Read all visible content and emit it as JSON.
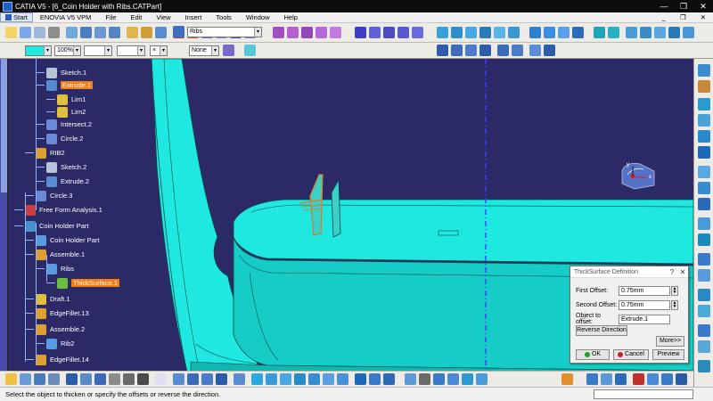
{
  "window": {
    "title": "CATIA V5 - [6_Coin Holder with Ribs.CATPart]",
    "minimize": "—",
    "restore": "❐",
    "close": "✕"
  },
  "menubar": {
    "items": [
      "Start",
      "ENOVIA V5 VPM",
      "File",
      "Edit",
      "View",
      "Insert",
      "Tools",
      "Window",
      "Help"
    ],
    "child_controls": [
      "_",
      "❐",
      "✕"
    ]
  },
  "toolbar2": {
    "color_combo": "",
    "transparency_combo": "100%",
    "linetype_combo": "",
    "thickness_combo": "",
    "point_combo": "×",
    "layer_combo": "None",
    "layer_label": "Ribs"
  },
  "tree": {
    "nodes": [
      {
        "label": "Sketch.1",
        "icon": "sketch-icon"
      },
      {
        "label": "Extrude.1",
        "icon": "extrude-icon",
        "selected": true
      },
      {
        "label": "Lim1",
        "icon": "limit-icon"
      },
      {
        "label": "Lim2",
        "icon": "limit-icon"
      },
      {
        "label": "Intersect.2",
        "icon": "intersect-icon"
      },
      {
        "label": "Circle.2",
        "icon": "circle-icon"
      },
      {
        "label": "RIB2",
        "icon": "geometrical-set-icon"
      },
      {
        "label": "Sketch.2",
        "icon": "sketch-icon"
      },
      {
        "label": "Extrude.2",
        "icon": "extrude-icon"
      },
      {
        "label": "Circle.3",
        "icon": "circle-icon"
      },
      {
        "label": "Free Form Analysis.1",
        "icon": "analysis-icon"
      },
      {
        "label": "Coin Holder Part",
        "icon": "part-icon"
      },
      {
        "label": "Coin Holder Part",
        "icon": "body-icon"
      },
      {
        "label": "Assemble.1",
        "icon": "assemble-icon"
      },
      {
        "label": "Ribs",
        "icon": "body-icon"
      },
      {
        "label": "ThickSurface.1",
        "icon": "thicksurface-icon",
        "selected": true
      },
      {
        "label": "Draft.1",
        "icon": "draft-icon"
      },
      {
        "label": "EdgeFillet.13",
        "icon": "edgefillet-icon"
      },
      {
        "label": "Assemble.2",
        "icon": "assemble-icon"
      },
      {
        "label": "Rib2",
        "icon": "body-icon"
      },
      {
        "label": "EdgeFillet.14",
        "icon": "edgefillet-icon"
      }
    ]
  },
  "dialog": {
    "title": "ThickSurface Definition",
    "help": "?",
    "close": "✕",
    "first_offset_label": "First Offset:",
    "first_offset_value": "0.75mm",
    "second_offset_label": "Second Offset:",
    "second_offset_value": "0.75mm",
    "object_label": "Object to offset:",
    "object_value": "Extrude.1",
    "reverse_button": "Reverse Direction",
    "more_button": "More>>",
    "ok_button": "OK",
    "cancel_button": "Cancel",
    "preview_button": "Preview"
  },
  "status": {
    "message": "Select the object to thicken or specify the offsets or reverse the direction."
  },
  "compass": {
    "axis_x": "x",
    "axis_y": "y"
  },
  "colors": {
    "viewport_bg": "#2c2a66",
    "part_cyan": "#1ee8e0",
    "part_cyan_dark": "#12b6b0",
    "selection_orange": "#f57d16",
    "axis_blue": "#3f3fff"
  }
}
